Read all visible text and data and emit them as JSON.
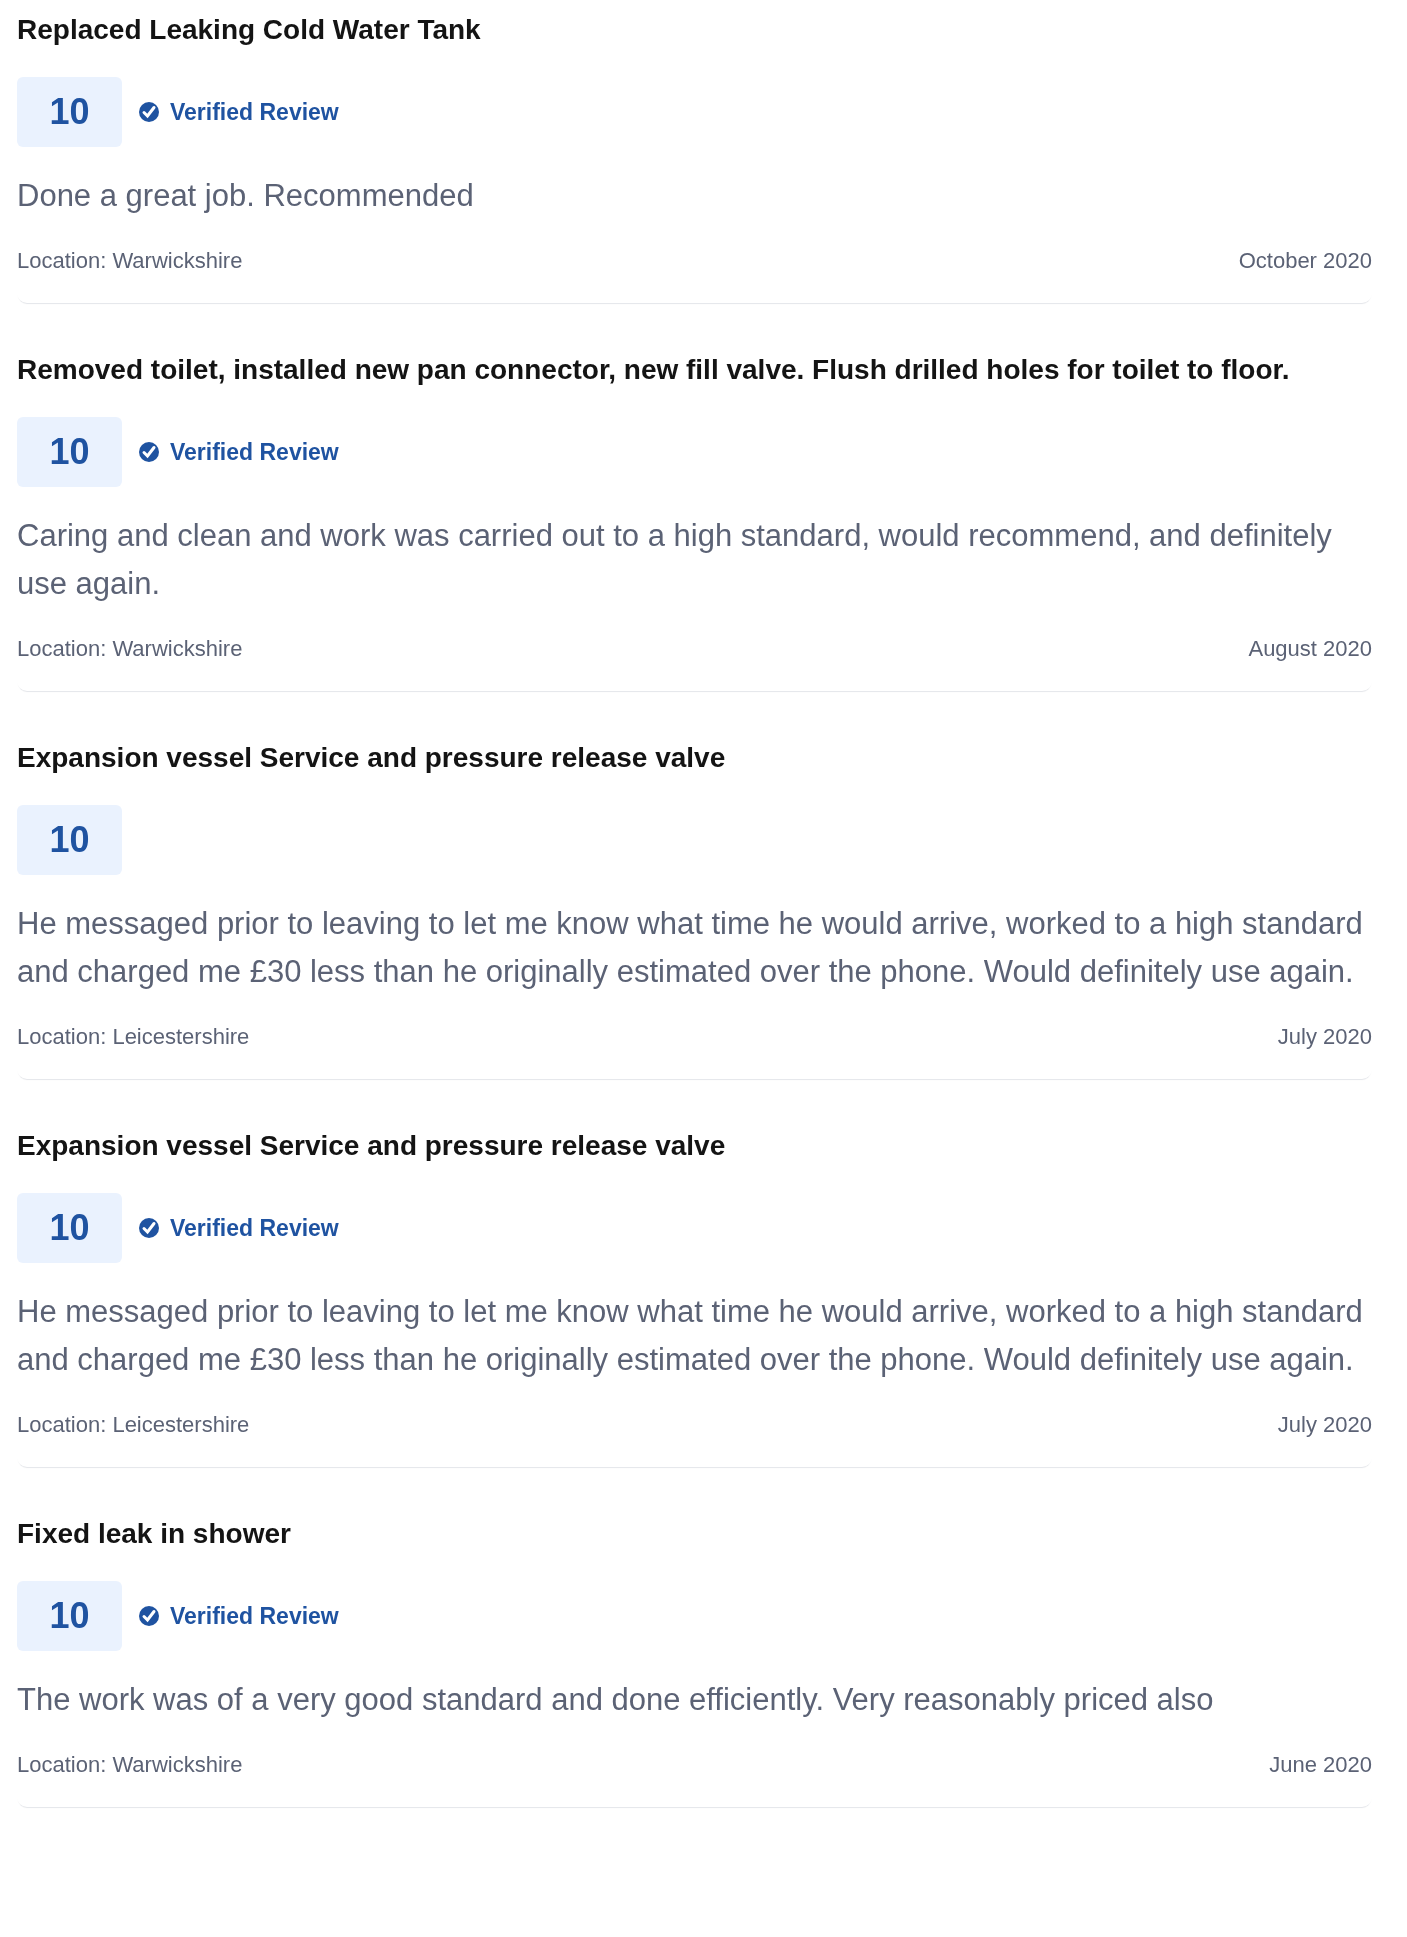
{
  "reviews": [
    {
      "title": "Replaced Leaking Cold Water Tank",
      "score": "10",
      "verified": true,
      "verified_label": "Verified Review",
      "text": "Done a great job. Recommended",
      "location": "Location: Warwickshire",
      "date": "October 2020"
    },
    {
      "title": "Removed toilet, installed new pan connector, new fill valve. Flush drilled holes for toilet to floor.",
      "score": "10",
      "verified": true,
      "verified_label": "Verified Review",
      "text": "Caring and clean and work was carried out to a high standard, would recommend, and definitely use again.",
      "location": "Location: Warwickshire",
      "date": "August 2020"
    },
    {
      "title": "Expansion vessel Service and pressure release valve",
      "score": "10",
      "verified": false,
      "text": "He messaged prior to leaving to let me know what time he would arrive, worked to a high standard and charged me £30 less than he originally estimated over the phone. Would definitely use again.",
      "location": "Location: Leicestershire",
      "date": "July 2020"
    },
    {
      "title": "Expansion vessel Service and pressure release valve",
      "score": "10",
      "verified": true,
      "verified_label": "Verified Review",
      "text": "He messaged prior to leaving to let me know what time he would arrive, worked to a high standard and charged me £30 less than he originally estimated over the phone. Would definitely use again.",
      "location": "Location: Leicestershire",
      "date": "July 2020"
    },
    {
      "title": "Fixed leak in shower",
      "score": "10",
      "verified": true,
      "verified_label": "Verified Review",
      "text": "The work was of a very good standard and done efficiently. Very reasonably priced also",
      "location": "Location: Warwickshire",
      "date": "June 2020"
    }
  ]
}
